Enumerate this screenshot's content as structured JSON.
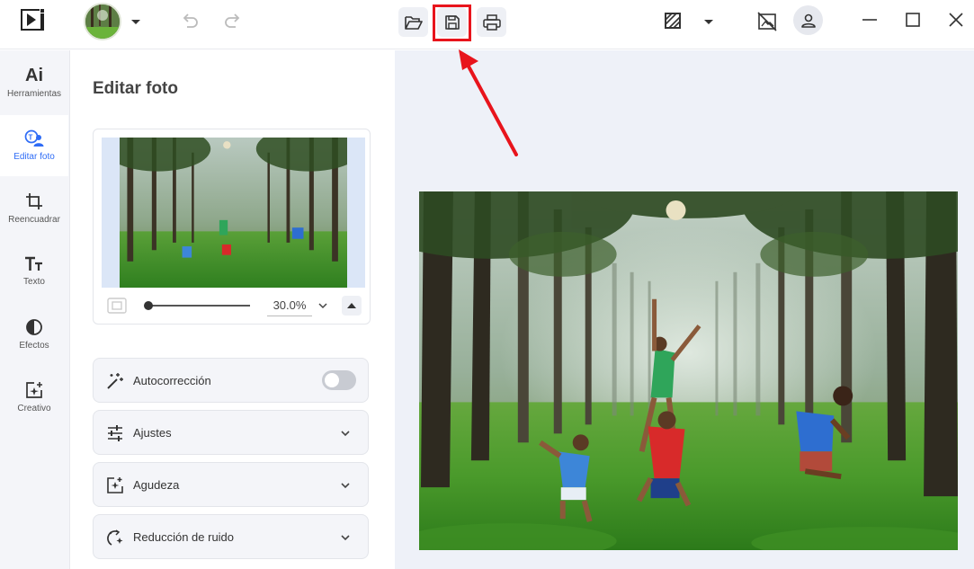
{
  "app": {
    "logo": "play-logo-icon"
  },
  "toolbar": {
    "avatar": "profile-thumbnail",
    "icons": [
      "undo-icon",
      "redo-icon",
      "open-folder-icon",
      "save-icon",
      "print-icon",
      "compare-icon",
      "no-image-icon",
      "user-icon"
    ]
  },
  "window": {
    "controls": [
      "minimize",
      "maximize",
      "close"
    ]
  },
  "leftnav": {
    "items": [
      {
        "label": "Herramientas",
        "icon": "ai-icon",
        "glyph": "Ai",
        "active": false
      },
      {
        "label": "Editar foto",
        "icon": "edit-photo-icon",
        "active": true
      },
      {
        "label": "Reencuadrar",
        "icon": "crop-icon",
        "active": false
      },
      {
        "label": "Texto",
        "icon": "text-icon",
        "active": false
      },
      {
        "label": "Efectos",
        "icon": "effects-icon",
        "active": false
      },
      {
        "label": "Creativo",
        "icon": "creative-icon",
        "active": false
      }
    ]
  },
  "panel": {
    "title": "Editar foto",
    "zoom": {
      "value": "30.0%",
      "slider_fraction": 0.0
    },
    "sections": [
      {
        "label": "Autocorrección",
        "icon": "magic-wand-icon",
        "control": "toggle",
        "on": false
      },
      {
        "label": "Ajustes",
        "icon": "sliders-icon",
        "control": "chevron"
      },
      {
        "label": "Agudeza",
        "icon": "sharpen-icon",
        "control": "chevron"
      },
      {
        "label": "Reducción de ruido",
        "icon": "denoise-icon",
        "control": "chevron"
      }
    ]
  },
  "colors": {
    "accent": "#2e6cf6",
    "highlight": "#e8141c",
    "canvas_bg": "#eef1f8"
  }
}
